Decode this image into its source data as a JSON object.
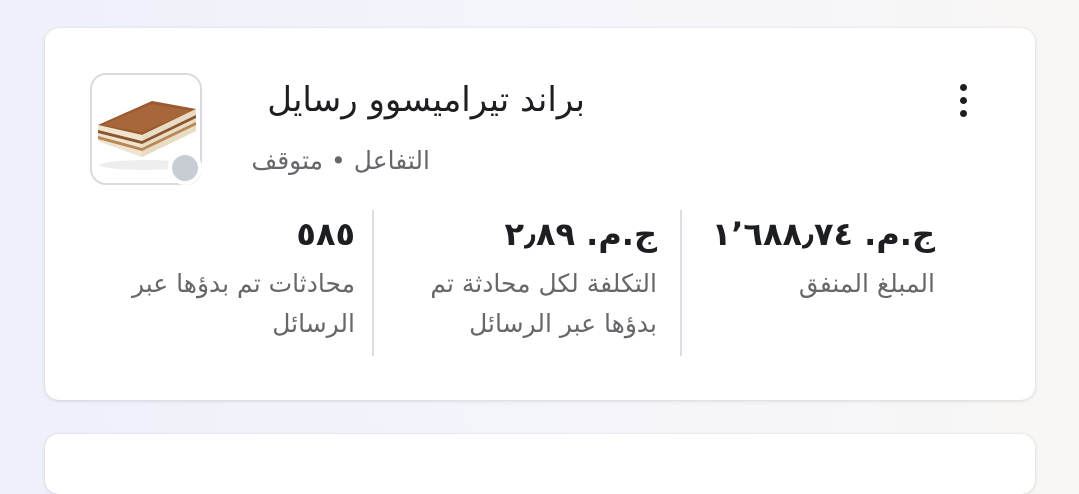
{
  "campaign": {
    "title": "براند تيراميسوو رسايل",
    "objective": "التفاعل",
    "separator": "•",
    "status": "متوقف",
    "thumbnail": "tiramisu-cake-image",
    "more_icon": "more-vertical-icon"
  },
  "metrics": [
    {
      "value": "ج.م. ١٬٦٨٨٫٧٤",
      "label": "المبلغ المنفق"
    },
    {
      "value": "ج.م. ٢٫٨٩",
      "label": "التكلفة لكل محادثة تم بدؤها عبر الرسائل"
    },
    {
      "value": "٥٨٥",
      "label": "محادثات تم بدؤها عبر الرسائل"
    }
  ],
  "colors": {
    "text_primary": "#1c1e21",
    "text_secondary": "#65676b",
    "status_paused": "#c8cdd3",
    "divider": "#dadde1"
  }
}
